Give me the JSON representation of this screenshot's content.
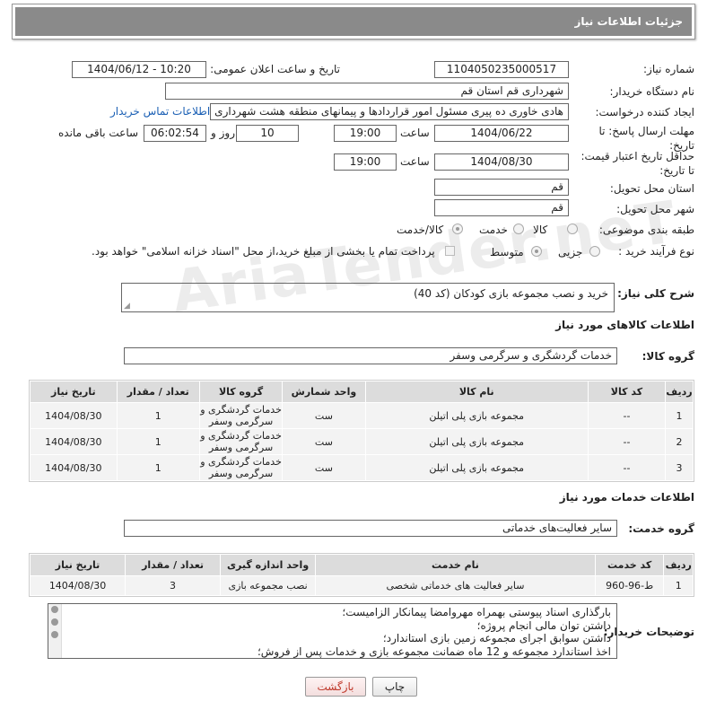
{
  "header": {
    "title": "جزئیات اطلاعات نیاز"
  },
  "fields": {
    "need_number_label": "شماره نیاز:",
    "need_number": "1104050235000517",
    "announce_label": "تاریخ و ساعت اعلان عمومی:",
    "announce_value": "1404/06/12 - 10:20",
    "buyer_label": "نام دستگاه خریدار:",
    "buyer_value": "شهرداری قم استان قم",
    "creator_label": "ایجاد کننده درخواست:",
    "creator_value": "هادی خاوری ده پیری مسئول امور قراردادها و پیمانهای منطقه هشت شهرداری",
    "contact_link": "اطلاعات تماس خریدار",
    "deadline_label": "مهلت ارسال پاسخ: تا تاریخ:",
    "deadline_date": "1404/06/22",
    "time_label": "ساعت",
    "deadline_time": "19:00",
    "days_value": "10",
    "days_label": "روز و",
    "remaining_time": "06:02:54",
    "remaining_label": "ساعت باقی مانده",
    "price_validity_label": "حداقل تاریخ اعتبار قیمت: تا تاریخ:",
    "price_validity_date": "1404/08/30",
    "price_validity_time": "19:00",
    "province_label": "استان محل تحویل:",
    "province_value": "قم",
    "city_label": "شهر محل تحویل:",
    "city_value": "قم",
    "category_label": "طبقه بندی موضوعی:",
    "category_options": [
      "کالا",
      "خدمت",
      "کالا/خدمت"
    ],
    "category_selected": "کالا/خدمت",
    "process_label": "نوع فرآیند خرید :",
    "process_options": [
      "جزیی",
      "متوسط"
    ],
    "process_selected": "متوسط",
    "payment_note": "پرداخت تمام یا بخشی از مبلغ خرید،از محل \"اسناد خزانه اسلامی\" خواهد بود."
  },
  "description": {
    "label": "شرح کلی نیاز:",
    "value": "خرید و نصب مجموعه بازی کودکان (کد 40)"
  },
  "goods_section": {
    "title": "اطلاعات کالاهای مورد نیاز",
    "group_label": "گروه کالا:",
    "group_value": "خدمات گردشگری و سرگرمی وسفر",
    "columns": [
      "ردیف",
      "کد کالا",
      "نام کالا",
      "واحد شمارش",
      "گروه کالا",
      "تعداد / مقدار",
      "تاریخ نیاز"
    ],
    "rows": [
      [
        "1",
        "--",
        "مجموعه بازی پلی اتیلن",
        "ست",
        "خدمات گردشگری و سرگرمی وسفر",
        "1",
        "1404/08/30"
      ],
      [
        "2",
        "--",
        "مجموعه بازی پلی اتیلن",
        "ست",
        "خدمات گردشگری و سرگرمی وسفر",
        "1",
        "1404/08/30"
      ],
      [
        "3",
        "--",
        "مجموعه بازی پلی اتیلن",
        "ست",
        "خدمات گردشگری و سرگرمی وسفر",
        "1",
        "1404/08/30"
      ]
    ]
  },
  "services_section": {
    "title": "اطلاعات خدمات مورد نیاز",
    "group_label": "گروه خدمت:",
    "group_value": "سایر فعالیت‌های خدماتی",
    "columns": [
      "ردیف",
      "کد خدمت",
      "نام خدمت",
      "واحد اندازه گیری",
      "تعداد / مقدار",
      "تاریخ نیاز"
    ],
    "rows": [
      [
        "1",
        "ط-96-960",
        "سایر فعالیت های خدماتی شخصی",
        "نصب مجموعه بازی",
        "3",
        "1404/08/30"
      ]
    ]
  },
  "buyer_notes": {
    "label": "توضیحات خریدار:",
    "lines": [
      "بارگذاری اسناد پیوستی بهمراه مهروامضا پیمانکار الزامیست؛",
      "داشتن توان مالی انجام پروژه؛",
      "داشتن سوابق اجرای مجموعه زمین بازی استاندارد؛",
      "اخذ استاندارد مجموعه و 12 ماه ضمانت مجموعه بازی و خدمات پس از فروش؛"
    ]
  },
  "buttons": {
    "print": "چاپ",
    "back": "بازگشت"
  },
  "watermark": "AriaTender.neT"
}
